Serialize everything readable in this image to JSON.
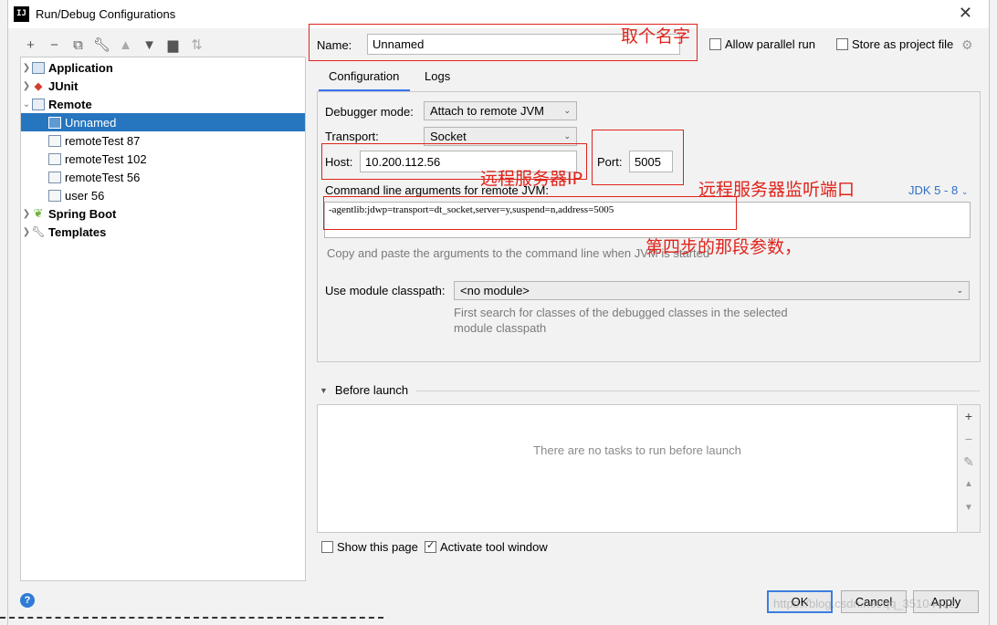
{
  "window": {
    "title": "Run/Debug Configurations",
    "app_icon_text": "IJ"
  },
  "toolbar": [
    "add-icon",
    "remove-icon",
    "copy-icon",
    "wrench-icon",
    "move-up-icon",
    "move-down-icon",
    "folder-icon",
    "sort-icon"
  ],
  "tree": {
    "application": "Application",
    "junit": "JUnit",
    "remote": "Remote",
    "unnamed": "Unnamed",
    "remote_test_87": "remoteTest 87",
    "remote_test_102": "remoteTest 102",
    "remote_test_56": "remoteTest 56",
    "user_56": "user 56",
    "spring_boot": "Spring Boot",
    "templates": "Templates"
  },
  "name": {
    "label": "Name:",
    "value": "Unnamed"
  },
  "options": {
    "allow_parallel": "Allow parallel run",
    "store_project": "Store as project file"
  },
  "tabs": {
    "configuration": "Configuration",
    "logs": "Logs"
  },
  "config": {
    "debugger_mode_label": "Debugger mode:",
    "debugger_mode_value": "Attach to remote JVM",
    "transport_label": "Transport:",
    "transport_value": "Socket",
    "host_label": "Host:",
    "host_value": "10.200.112.56",
    "port_label": "Port:",
    "port_value": "5005",
    "cmd_label": "Command line arguments for remote JVM:",
    "jdk_link": "JDK 5 - 8",
    "cmd_value": "-agentlib:jdwp=transport=dt_socket,server=y,suspend=n,address=5005",
    "cmd_hint": "Copy and paste the arguments to the command line when JVM is started",
    "module_label": "Use module classpath:",
    "module_value": "<no module>",
    "module_hint_1": "First search for classes of the debugged classes in the selected",
    "module_hint_2": "module classpath"
  },
  "annotations": {
    "name": "取个名字",
    "host": "远程服务器IP",
    "port": "远程服务器监听端口",
    "cmd": "第四步的那段参数，"
  },
  "before_launch": {
    "title": "Before launch",
    "empty": "There are no tasks to run before launch"
  },
  "bottom": {
    "show_page": "Show this page",
    "activate_tool": "Activate tool window",
    "ok": "OK",
    "cancel": "Cancel",
    "apply": "Apply",
    "watermark": "https://blog.csdn.net/qq_35104432"
  },
  "colors": {
    "selection": "#2675bf",
    "annotation": "#e0231b",
    "link": "#2f6fc4"
  }
}
